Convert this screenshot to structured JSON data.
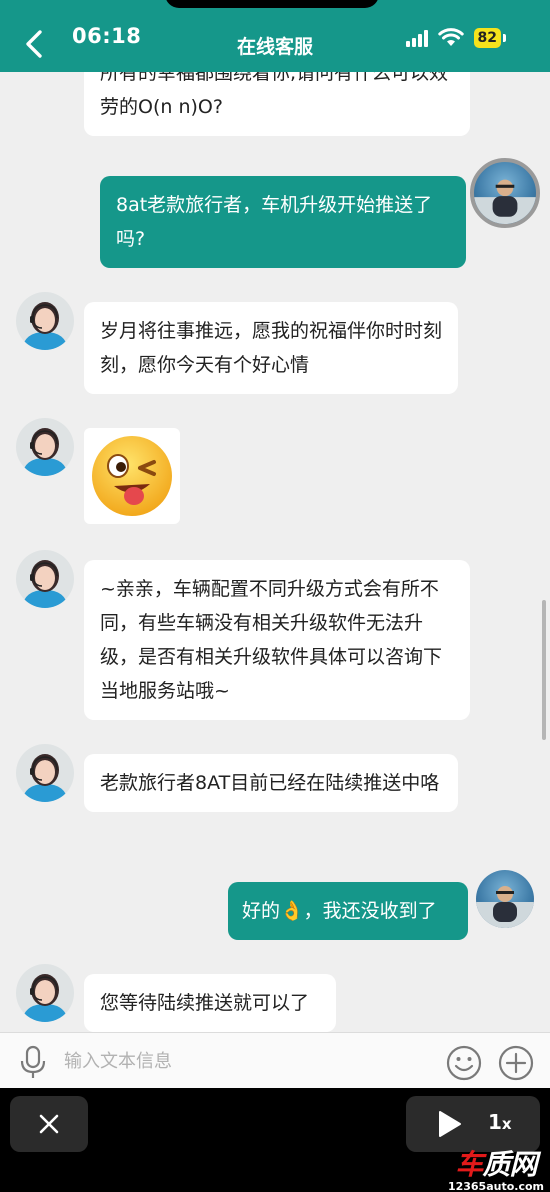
{
  "status_bar": {
    "time": "06:18",
    "battery": "82"
  },
  "header": {
    "title": "在线客服"
  },
  "messages": [
    {
      "side": "left",
      "text": "所有的幸福都围绕着你,请问有什么可以效劳的O(n n)O?"
    },
    {
      "side": "right",
      "text": "8at老款旅行者，车机升级开始推送了吗?"
    },
    {
      "side": "left",
      "text": "岁月将往事推远，愿我的祝福伴你时时刻刻，愿你今天有个好心情"
    },
    {
      "side": "left",
      "type": "emoji",
      "emoji": "wink-tongue-emoji"
    },
    {
      "side": "left",
      "text": "~亲亲，车辆配置不同升级方式会有所不同，有些车辆没有相关升级软件无法升级，是否有相关升级软件具体可以咨询下当地服务站哦~"
    },
    {
      "side": "left",
      "text": "老款旅行者8AT目前已经在陆续推送中咯"
    },
    {
      "side": "right",
      "text": "好的👌，我还没收到了"
    },
    {
      "side": "left",
      "text": "您等待陆续推送就可以了"
    }
  ],
  "input": {
    "placeholder": "输入文本信息",
    "value": ""
  },
  "player": {
    "speed": "1",
    "speed_unit": "x"
  },
  "watermark": {
    "brand_a": "车",
    "brand_b": "质网",
    "url": "12365auto.com"
  },
  "colors": {
    "accent": "#15978a",
    "bubble_left": "#ffffff",
    "chat_bg": "#efefef",
    "battery": "#f5e21c"
  },
  "icons": [
    "back-arrow-icon",
    "signal-icon",
    "wifi-icon",
    "battery-icon",
    "mic-icon",
    "emoji-icon",
    "plus-icon",
    "close-icon",
    "play-icon"
  ]
}
